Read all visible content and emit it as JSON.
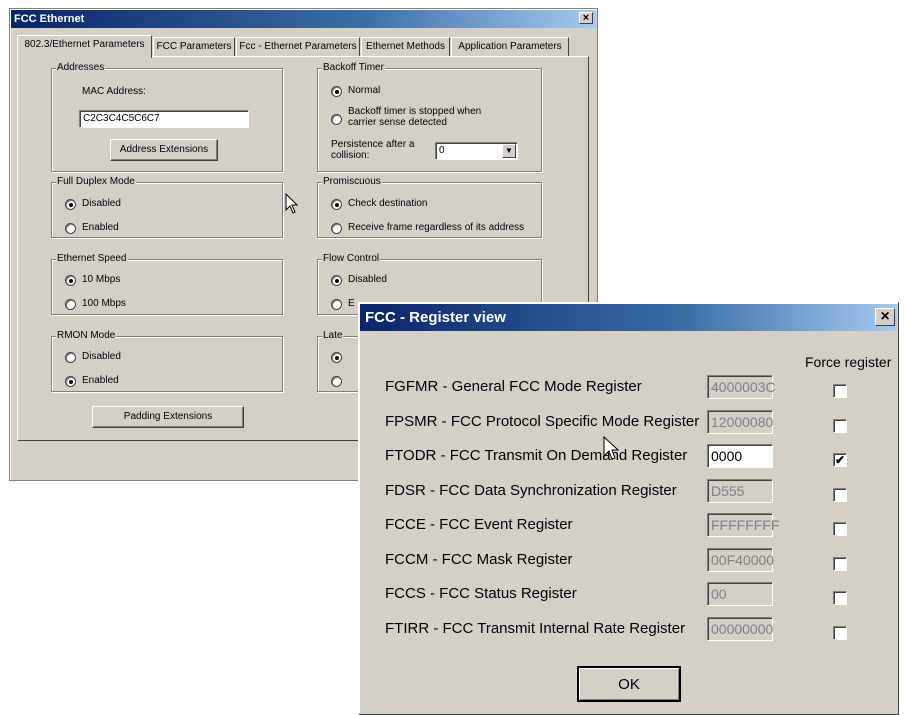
{
  "fcc_window": {
    "title": "FCC Ethernet",
    "close": "×",
    "tabs": [
      "802.3/Ethernet Parameters",
      "FCC Parameters",
      "Fcc - Ethernet Parameters",
      "Ethernet Methods",
      "Application Parameters"
    ],
    "addresses": {
      "group": "Addresses",
      "mac_label": "MAC Address:",
      "mac_value": "C2C3C4C5C6C7",
      "ext_button": "Address Extensions"
    },
    "full_duplex": {
      "group": "Full Duplex Mode",
      "options": [
        "Disabled",
        "Enabled"
      ],
      "selected": 0
    },
    "speed": {
      "group": "Ethernet Speed",
      "options": [
        "10 Mbps",
        "100 Mbps"
      ],
      "selected": 0
    },
    "rmon": {
      "group": "RMON Mode",
      "options": [
        "Disabled",
        "Enabled"
      ],
      "selected": 1
    },
    "padding_button": "Padding Extensions",
    "backoff": {
      "group": "Backoff Timer",
      "normal": "Normal",
      "stopped_line1": "Backoff timer is stopped when",
      "stopped_line2": "carrier sense detected",
      "persistence_line1": "Persistence after a",
      "persistence_line2": "collision:",
      "persistence_value": "0"
    },
    "promiscuous": {
      "group": "Promiscuous",
      "options": [
        "Check destination",
        "Receive frame regardless of its address"
      ],
      "selected": 0
    },
    "flow_control": {
      "group": "Flow Control",
      "options": [
        "Disabled",
        "E"
      ],
      "selected": 0
    },
    "late": {
      "group": "Late",
      "options": [
        "",
        ""
      ],
      "selected": 0
    }
  },
  "register_view": {
    "title": "FCC - Register view",
    "close": "×",
    "force_header": "Force register",
    "rows": [
      {
        "label": "FGFMR - General FCC Mode Register",
        "value": "4000003C",
        "editable": false,
        "checked": false
      },
      {
        "label": "FPSMR - FCC Protocol Specific Mode Register",
        "value": "12000080",
        "editable": false,
        "checked": false
      },
      {
        "label": "FTODR - FCC Transmit On Demand Register",
        "value": "0000",
        "editable": true,
        "checked": true
      },
      {
        "label": "FDSR - FCC Data Synchronization Register",
        "value": "D555",
        "editable": false,
        "checked": false
      },
      {
        "label": "FCCE - FCC Event Register",
        "value": "FFFFFFFF",
        "editable": false,
        "checked": false
      },
      {
        "label": "FCCM - FCC Mask Register",
        "value": "00F40000",
        "editable": false,
        "checked": false
      },
      {
        "label": "FCCS - FCC Status Register",
        "value": "00",
        "editable": false,
        "checked": false
      },
      {
        "label": "FTIRR - FCC Transmit Internal Rate Register",
        "value": "00000000",
        "editable": false,
        "checked": false
      }
    ],
    "ok_button": "OK",
    "check_mark": "✔"
  },
  "colors": {
    "titlebar_active": "#0a246a",
    "face": "#d4d0c8"
  }
}
